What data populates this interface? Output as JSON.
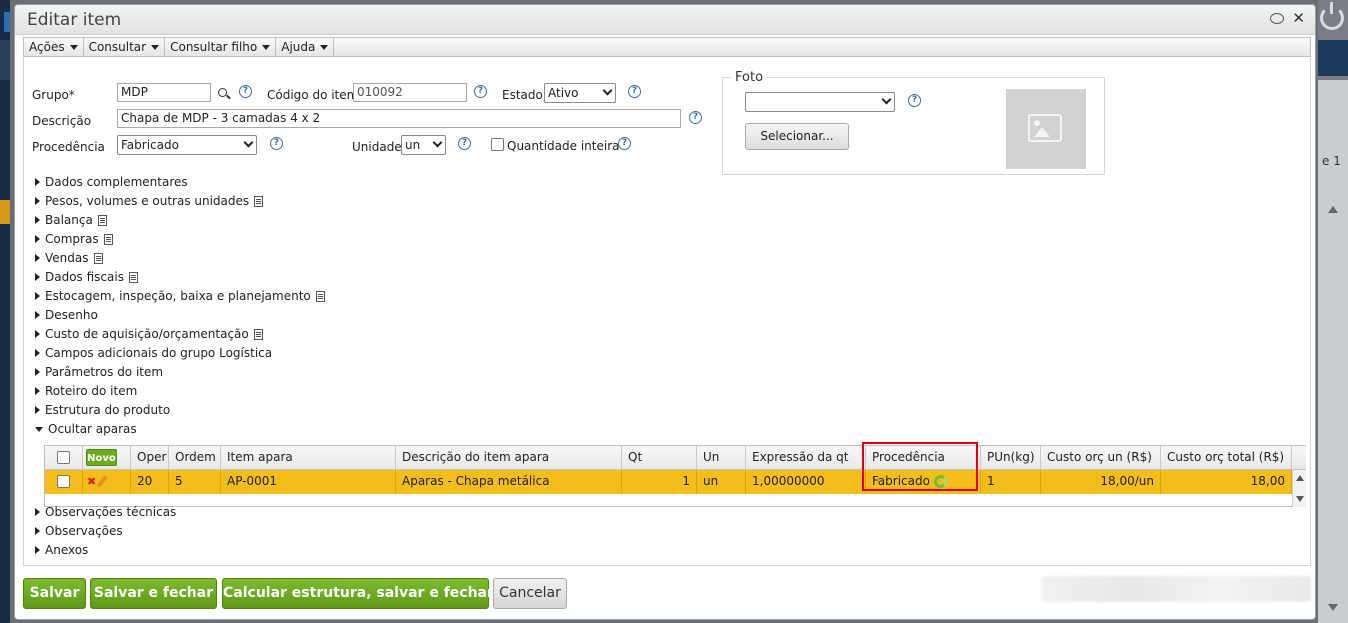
{
  "dialog": {
    "title": "Editar item"
  },
  "menu": [
    "Ações",
    "Consultar",
    "Consultar filho",
    "Ajuda"
  ],
  "form": {
    "grupo_label": "Grupo*",
    "grupo_value": "MDP",
    "codigo_label": "Código do item",
    "codigo_value": "010092",
    "estado_label": "Estado",
    "estado_value": "Ativo",
    "descricao_label": "Descrição",
    "descricao_value": "Chapa de MDP - 3 camadas 4 x 2",
    "procedencia_label": "Procedência",
    "procedencia_value": "Fabricado",
    "unidade_label": "Unidade",
    "unidade_value": "un",
    "quantidade_inteira_label": "Quantidade inteira",
    "help_glyph": "?"
  },
  "foto": {
    "legend": "Foto",
    "select_value": "",
    "button_label": "Selecionar..."
  },
  "sections": [
    {
      "label": "Dados complementares",
      "doc": false
    },
    {
      "label": "Pesos, volumes e outras unidades",
      "doc": true
    },
    {
      "label": "Balança",
      "doc": true
    },
    {
      "label": "Compras",
      "doc": true
    },
    {
      "label": "Vendas",
      "doc": true
    },
    {
      "label": "Dados fiscais",
      "doc": true
    },
    {
      "label": "Estocagem, inspeção, baixa e planejamento",
      "doc": true
    },
    {
      "label": "Desenho",
      "doc": false
    },
    {
      "label": "Custo de aquisição/orçamentação",
      "doc": true
    },
    {
      "label": "Campos adicionais do grupo Logística",
      "doc": false
    },
    {
      "label": "Parâmetros do item",
      "doc": false
    },
    {
      "label": "Roteiro do item",
      "doc": false
    },
    {
      "label": "Estrutura do produto",
      "doc": false
    }
  ],
  "aparas": {
    "toggle_label": "Ocultar aparas",
    "novo_label": "Novo",
    "columns": [
      "Oper",
      "Ordem",
      "Item apara",
      "Descrição do item apara",
      "Qt",
      "Un",
      "Expressão da qt",
      "Procedência",
      "PUn(kg)",
      "Custo orç un (R$)",
      "Custo orç total (R$)"
    ],
    "rows": [
      {
        "oper": "20",
        "ordem": "5",
        "item": "AP-0001",
        "descricao": "Aparas - Chapa metálica",
        "qt": "1",
        "un": "un",
        "expressao": "1,00000000",
        "procedencia": "Fabricado",
        "pun": "1",
        "custo_un": "18,00/un",
        "custo_total": "18,00"
      }
    ]
  },
  "sections_after": [
    {
      "label": "Observações técnicas"
    },
    {
      "label": "Observações"
    },
    {
      "label": "Anexos"
    }
  ],
  "buttons": {
    "salvar": "Salvar",
    "salvar_fechar": "Salvar e fechar",
    "calcular": "Calcular estrutura, salvar e fechar",
    "cancelar": "Cancelar"
  },
  "background": {
    "page_indicator": "e 1"
  },
  "colors": {
    "selected_row": "#f3bd1b",
    "primary_button": "#6eaa1c",
    "highlight_border": "#e00000"
  }
}
